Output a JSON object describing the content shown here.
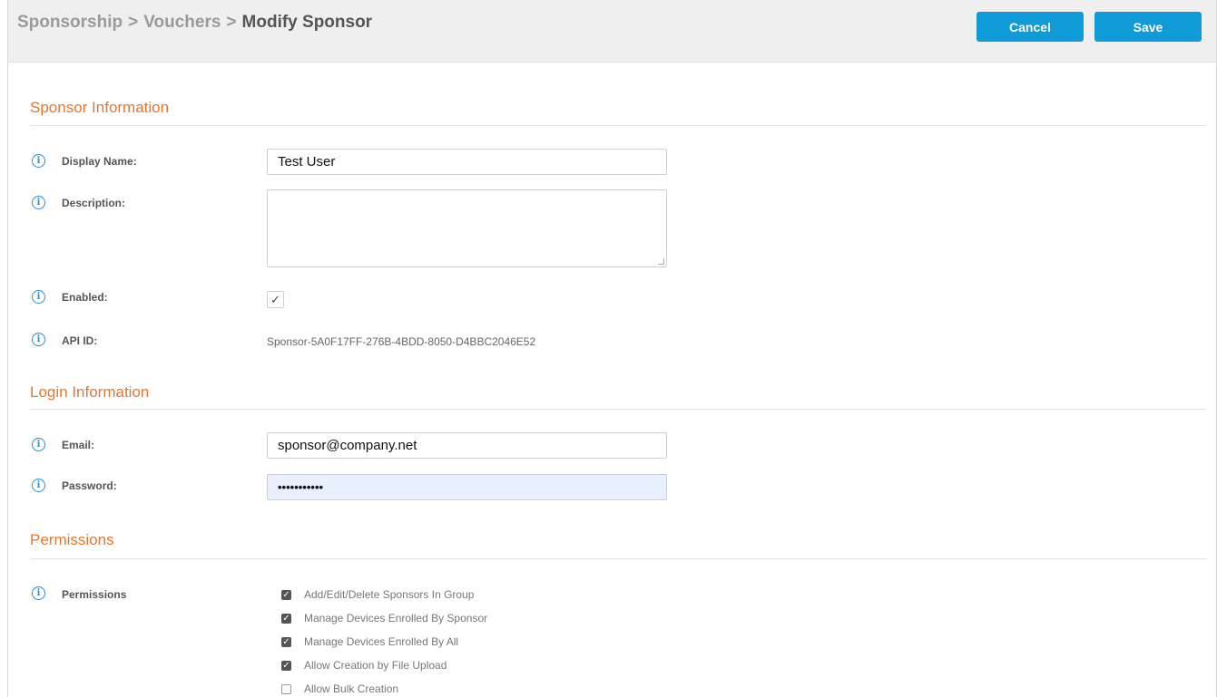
{
  "header": {
    "breadcrumb": [
      "Sponsorship",
      "Vouchers",
      "Modify Sponsor"
    ],
    "separator": ">",
    "cancel_label": "Cancel",
    "save_label": "Save",
    "accent_color": "#0f9bd7"
  },
  "sections": {
    "sponsor_info": "Sponsor Information",
    "login_info": "Login Information",
    "permissions": "Permissions"
  },
  "icons": {
    "info": "i",
    "info_name": "info-icon",
    "check": "✓"
  },
  "sponsor": {
    "display_name_label": "Display Name:",
    "display_name_value": "Test User",
    "description_label": "Description:",
    "description_value": "",
    "enabled_label": "Enabled:",
    "enabled_checked": true,
    "api_id_label": "API ID:",
    "api_id_value": "Sponsor-5A0F17FF-276B-4BDD-8050-D4BBC2046E52"
  },
  "login": {
    "email_label": "Email:",
    "email_value": "sponsor@company.net",
    "password_label": "Password:",
    "password_value": "•••••••••••"
  },
  "permissions": {
    "label": "Permissions",
    "items": [
      {
        "label": "Add/Edit/Delete Sponsors In Group",
        "checked": true
      },
      {
        "label": "Manage Devices Enrolled By Sponsor",
        "checked": true
      },
      {
        "label": "Manage Devices Enrolled By All",
        "checked": true
      },
      {
        "label": "Allow Creation by File Upload",
        "checked": true
      },
      {
        "label": "Allow Bulk Creation",
        "checked": false
      }
    ]
  },
  "colors": {
    "section_title": "#e8762c",
    "info_icon": "#2a8dd4",
    "header_bg": "#efefef"
  }
}
